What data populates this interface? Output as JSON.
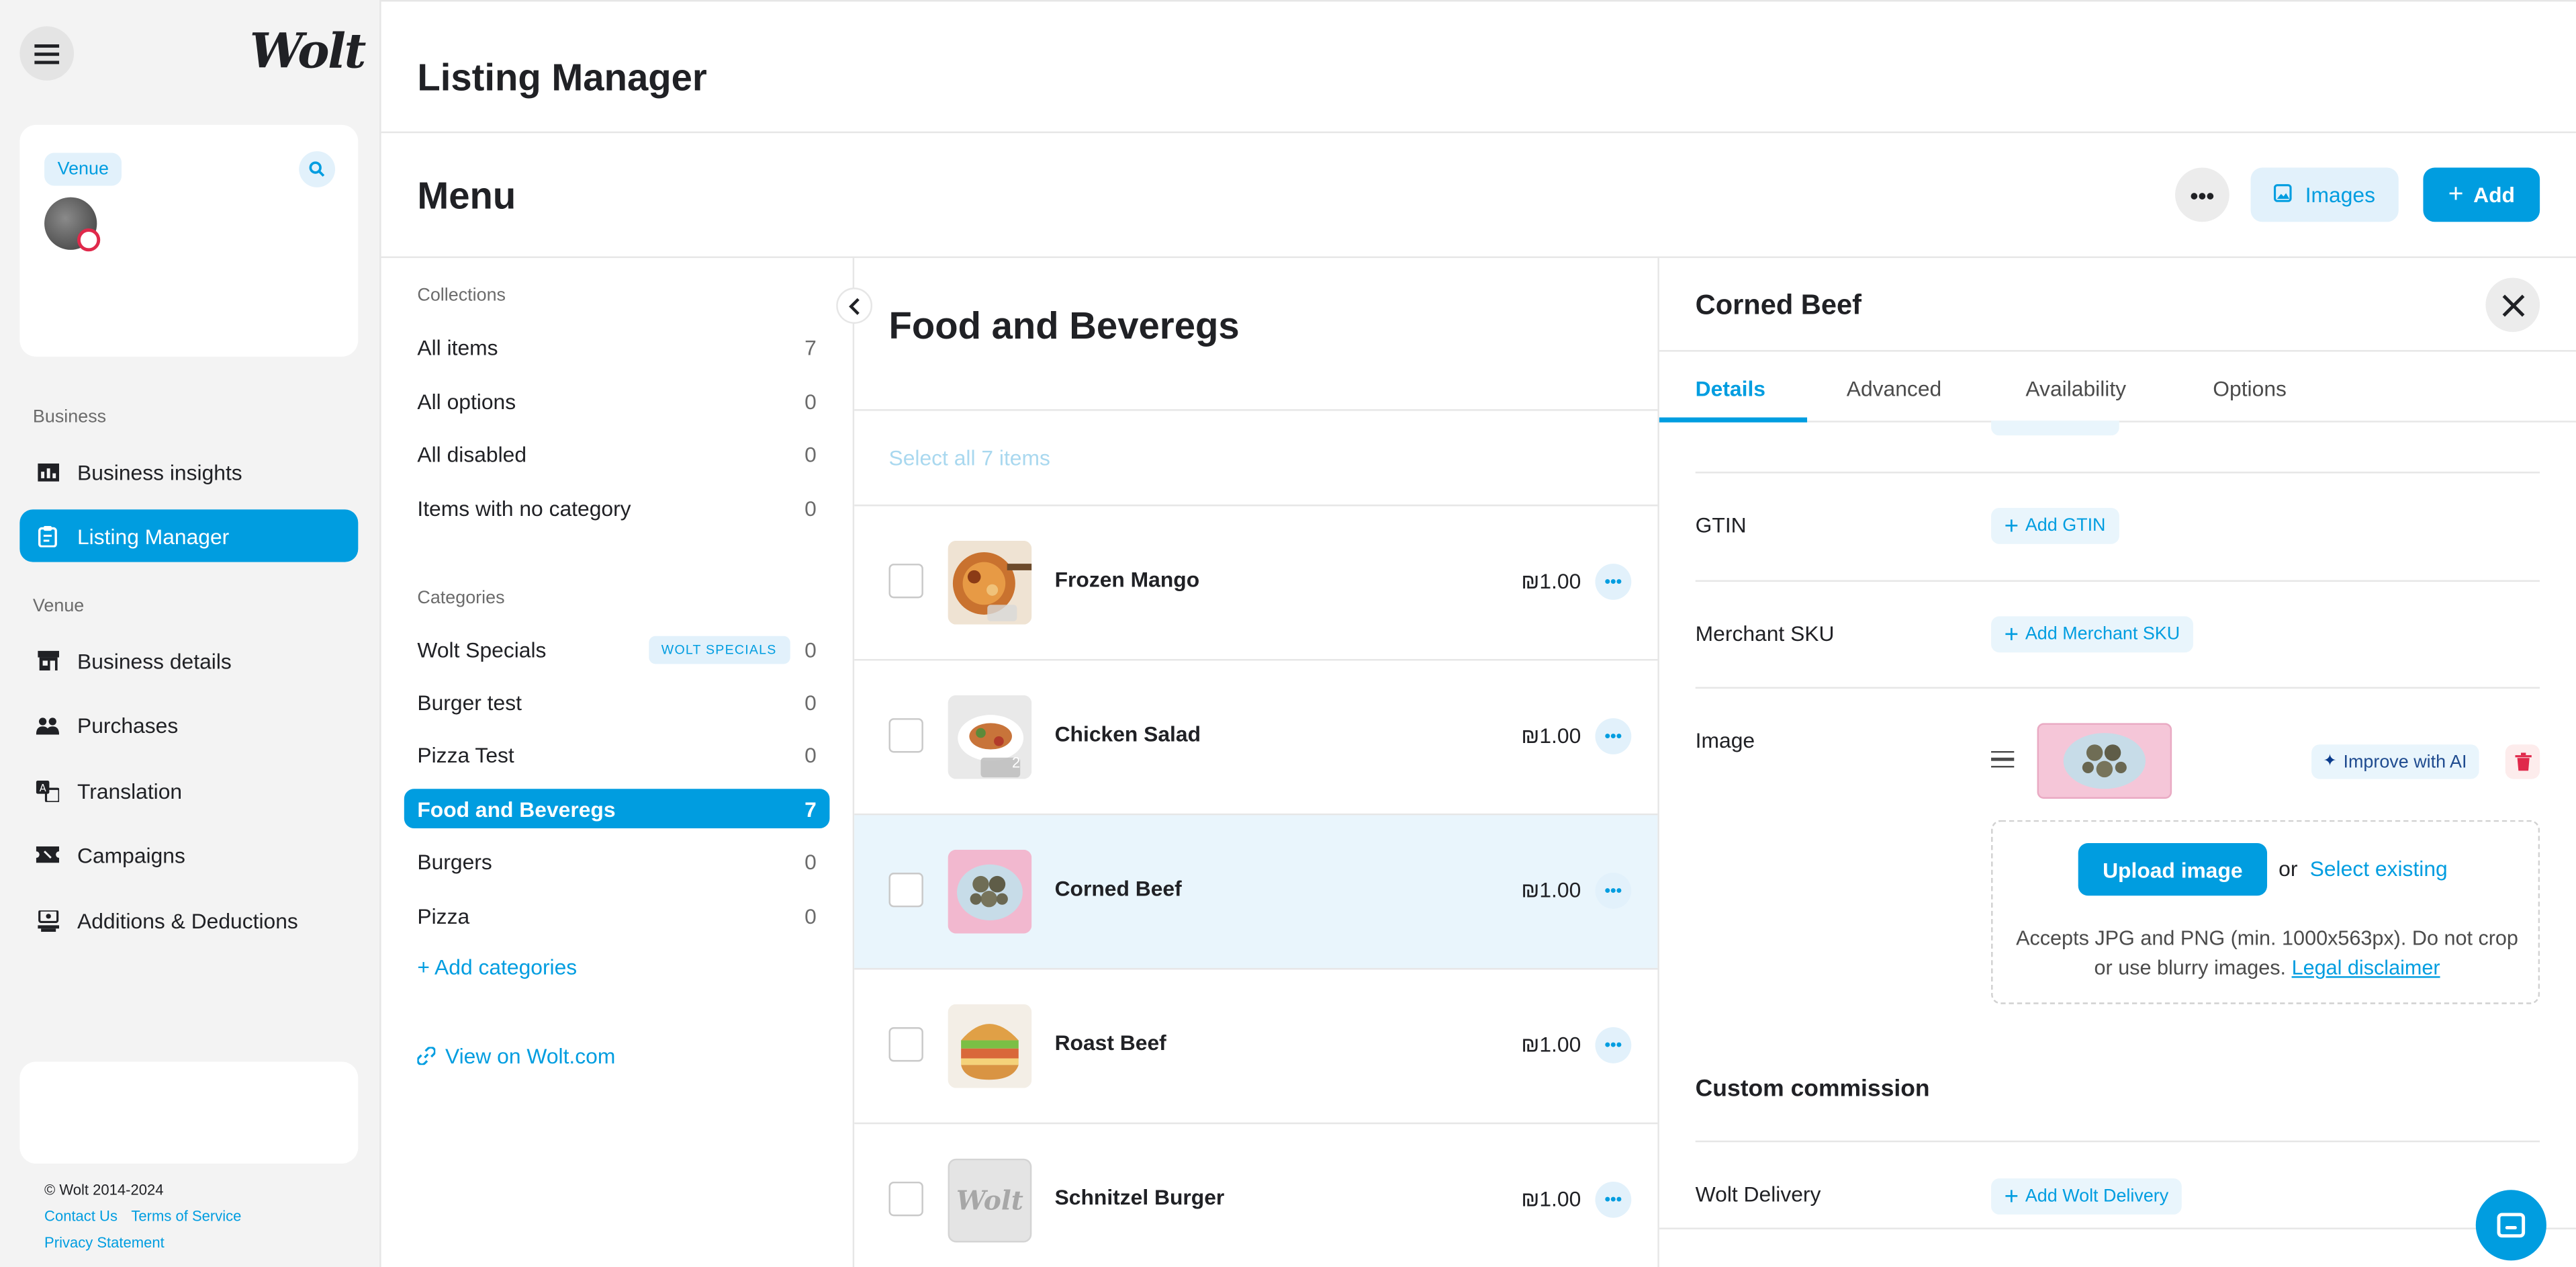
{
  "brand": {
    "logo_text": "Wolt",
    "accent": "#009de0"
  },
  "sidebar": {
    "venue_badge": "Venue",
    "sections": {
      "business": "Business",
      "venue": "Venue"
    },
    "items": [
      {
        "label": "Business insights",
        "icon": "chart-icon",
        "active": false
      },
      {
        "label": "Listing Manager",
        "icon": "clipboard-icon",
        "active": true
      },
      {
        "label": "Business details",
        "icon": "store-icon",
        "active": false
      },
      {
        "label": "Purchases",
        "icon": "people-icon",
        "active": false
      },
      {
        "label": "Translation",
        "icon": "translate-icon",
        "active": false
      },
      {
        "label": "Campaigns",
        "icon": "ticket-icon",
        "active": false
      },
      {
        "label": "Additions & Deductions",
        "icon": "register-icon",
        "active": false
      }
    ],
    "copyright": "© Wolt 2014-2024",
    "contact": "Contact Us",
    "terms": "Terms of Service",
    "privacy": "Privacy Statement"
  },
  "header": {
    "page_title": "Listing Manager",
    "menu_title": "Menu",
    "images_label": "Images",
    "add_label": "Add"
  },
  "collections": {
    "heading": "Collections",
    "rows": [
      {
        "label": "All items",
        "count": "7"
      },
      {
        "label": "All options",
        "count": "0"
      },
      {
        "label": "All disabled",
        "count": "0"
      },
      {
        "label": "Items with no category",
        "count": "0"
      }
    ]
  },
  "categories": {
    "heading": "Categories",
    "rows": [
      {
        "label": "Wolt Specials",
        "tag": "WOLT SPECIALS",
        "count": "0"
      },
      {
        "label": "Burger test",
        "count": "0"
      },
      {
        "label": "Pizza Test",
        "count": "0"
      },
      {
        "label": "Food and Beveregs",
        "count": "7",
        "active": true
      },
      {
        "label": "Burgers",
        "count": "0"
      },
      {
        "label": "Pizza",
        "count": "0"
      }
    ],
    "add_label": "+ Add categories",
    "view_label": "View on Wolt.com"
  },
  "items_panel": {
    "title": "Food and Beveregs",
    "select_all": "Select all 7 items",
    "items": [
      {
        "name": "Frozen Mango",
        "price": "₪1.00",
        "selected": false
      },
      {
        "name": "Chicken Salad",
        "price": "₪1.00",
        "selected": false
      },
      {
        "name": "Corned Beef",
        "price": "₪1.00",
        "selected": true
      },
      {
        "name": "Roast Beef",
        "price": "₪1.00",
        "selected": false
      },
      {
        "name": "Schnitzel Burger",
        "price": "₪1.00",
        "selected": false
      }
    ],
    "placeholder_logo": "Wolt",
    "photo_count": "2"
  },
  "detail": {
    "title": "Corned Beef",
    "tabs": [
      "Details",
      "Advanced",
      "Availability",
      "Options"
    ],
    "fields": {
      "gtin_label": "GTIN",
      "gtin_btn": "Add GTIN",
      "sku_label": "Merchant SKU",
      "sku_btn": "Add Merchant SKU",
      "image_label": "Image",
      "improve_ai": "Improve with AI",
      "upload_btn": "Upload image",
      "or_text": "or",
      "select_existing": "Select existing",
      "upload_help": "Accepts JPG and PNG (min. 1000x563px). Do not crop or use blurry images.",
      "legal": "Legal disclaimer",
      "custom_commission": "Custom commission",
      "delivery_label": "Wolt Delivery",
      "delivery_btn": "Add Wolt Delivery"
    }
  }
}
